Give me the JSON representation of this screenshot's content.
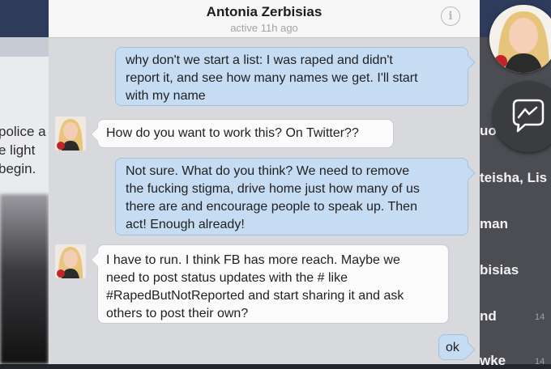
{
  "chat": {
    "title": "Antonia Zerbisias",
    "status": "active 11h ago",
    "info_icon": "i",
    "messages": [
      {
        "from": "me",
        "lines": [
          "why don't we start a list: I was raped and didn't",
          "report it, and see how many names we get. I'll start",
          "with my name"
        ]
      },
      {
        "from": "them",
        "lines": [
          "How do you want to work this? On Twitter??"
        ]
      },
      {
        "from": "me",
        "lines": [
          "Not sure. What do you think? We need to remove",
          "the fucking stigma, drive home just how many of us",
          "there are and encourage people to speak up. Then",
          "act! Enough already!"
        ]
      },
      {
        "from": "them",
        "lines": [
          "I have to run. I think FB has more reach. Maybe we",
          "need to post status updates with the # like",
          "#RapedButNotReported and start sharing it and ask",
          "others to post their own?"
        ]
      },
      {
        "from": "me",
        "lines": [
          "ok"
        ]
      }
    ]
  },
  "background": {
    "left_lines": [
      "police a",
      "e light",
      "begin."
    ],
    "right_rows": [
      {
        "text": "uo",
        "time": ""
      },
      {
        "text": "teisha, Lis",
        "time": ""
      },
      {
        "text": "man",
        "time": ""
      },
      {
        "text": "bisias",
        "time": ""
      },
      {
        "text": "nd",
        "time": "14"
      },
      {
        "text": "wke",
        "time": "14"
      }
    ]
  },
  "icons": {
    "info": "info-icon",
    "messenger": "messenger-icon",
    "avatar": "avatar"
  },
  "colors": {
    "outgoing_bubble": "#c5dcf3",
    "incoming_bubble": "#fbfbfb",
    "chat_background": "#d7d9dd",
    "header_background": "#f7f7f7"
  }
}
